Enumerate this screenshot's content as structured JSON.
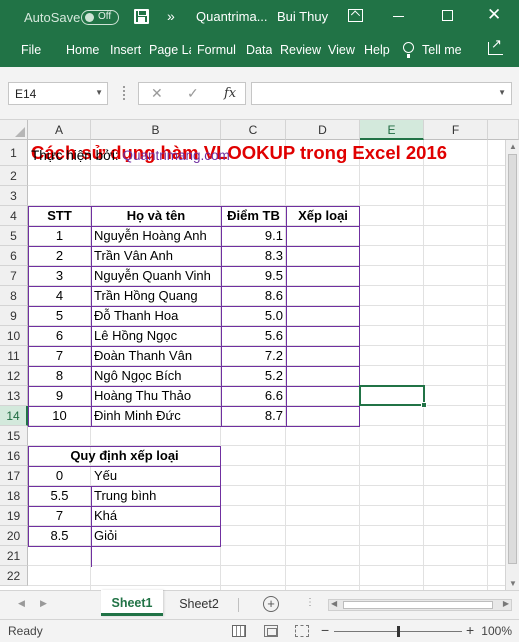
{
  "titlebar": {
    "autosave_label": "AutoSave",
    "autosave_state": "Off",
    "document_name": "Quantrima...",
    "user_name": "Bui Thuy",
    "more_glyph": "»",
    "close_glyph": "✕"
  },
  "menu": {
    "tabs": [
      "File",
      "Home",
      "Insert",
      "Page La",
      "Formul",
      "Data",
      "Review",
      "View",
      "Help"
    ],
    "tell_me": "Tell me"
  },
  "formula_bar": {
    "name_box": "E14",
    "cancel_glyph": "✕",
    "enter_glyph": "✓",
    "fx_label": "fx",
    "formula": ""
  },
  "grid": {
    "columns": [
      "A",
      "B",
      "C",
      "D",
      "E",
      "F"
    ],
    "active_column": "E",
    "rows": [
      "1",
      "2",
      "3",
      "4",
      "5",
      "6",
      "7",
      "8",
      "9",
      "10",
      "11",
      "12",
      "13",
      "14",
      "15",
      "16",
      "17",
      "18",
      "19",
      "20",
      "21",
      "22"
    ],
    "active_row": "14",
    "selected_cell": "E14"
  },
  "sheet": {
    "title": "Cách sử dụng hàm VLOOKUP trong Excel 2016",
    "subtitle_prefix": "Thực hiện bởi: ",
    "subtitle_link": "Quantrimang.com",
    "table_headers": {
      "stt": "STT",
      "name": "Họ và tên",
      "score": "Điểm TB",
      "rank": "Xếp loại"
    },
    "students": [
      {
        "stt": "1",
        "name": "Nguyễn Hoàng Anh",
        "score": "9.1",
        "rank": ""
      },
      {
        "stt": "2",
        "name": "Trần Vân Anh",
        "score": "8.3",
        "rank": ""
      },
      {
        "stt": "3",
        "name": "Nguyễn Quanh Vinh",
        "score": "9.5",
        "rank": ""
      },
      {
        "stt": "4",
        "name": "Trần Hồng Quang",
        "score": "8.6",
        "rank": ""
      },
      {
        "stt": "5",
        "name": "Đỗ Thanh Hoa",
        "score": "5.0",
        "rank": ""
      },
      {
        "stt": "6",
        "name": "Lê Hồng Ngọc",
        "score": "5.6",
        "rank": ""
      },
      {
        "stt": "7",
        "name": "Đoàn Thanh Vân",
        "score": "7.2",
        "rank": ""
      },
      {
        "stt": "8",
        "name": "Ngô Ngọc Bích",
        "score": "5.2",
        "rank": ""
      },
      {
        "stt": "9",
        "name": "Hoàng Thu Thảo",
        "score": "6.6",
        "rank": ""
      },
      {
        "stt": "10",
        "name": "Đinh Minh Đức",
        "score": "8.7",
        "rank": ""
      }
    ],
    "rule_title": "Quy định xếp loại",
    "rules": [
      {
        "threshold": "0",
        "label": "Yếu"
      },
      {
        "threshold": "5.5",
        "label": "Trung bình"
      },
      {
        "threshold": "7",
        "label": "Khá"
      },
      {
        "threshold": "8.5",
        "label": "Giỏi"
      }
    ]
  },
  "sheet_tabs": {
    "tabs": [
      "Sheet1",
      "Sheet2"
    ],
    "active": "Sheet1",
    "add_glyph": "+"
  },
  "statusbar": {
    "ready": "Ready",
    "zoom_minus": "−",
    "zoom_plus": "+",
    "zoom": "100%",
    "zoom_level": 1.0
  },
  "colors": {
    "accent": "#217346",
    "title_red": "#e00000",
    "border_purple": "#7030a0"
  }
}
